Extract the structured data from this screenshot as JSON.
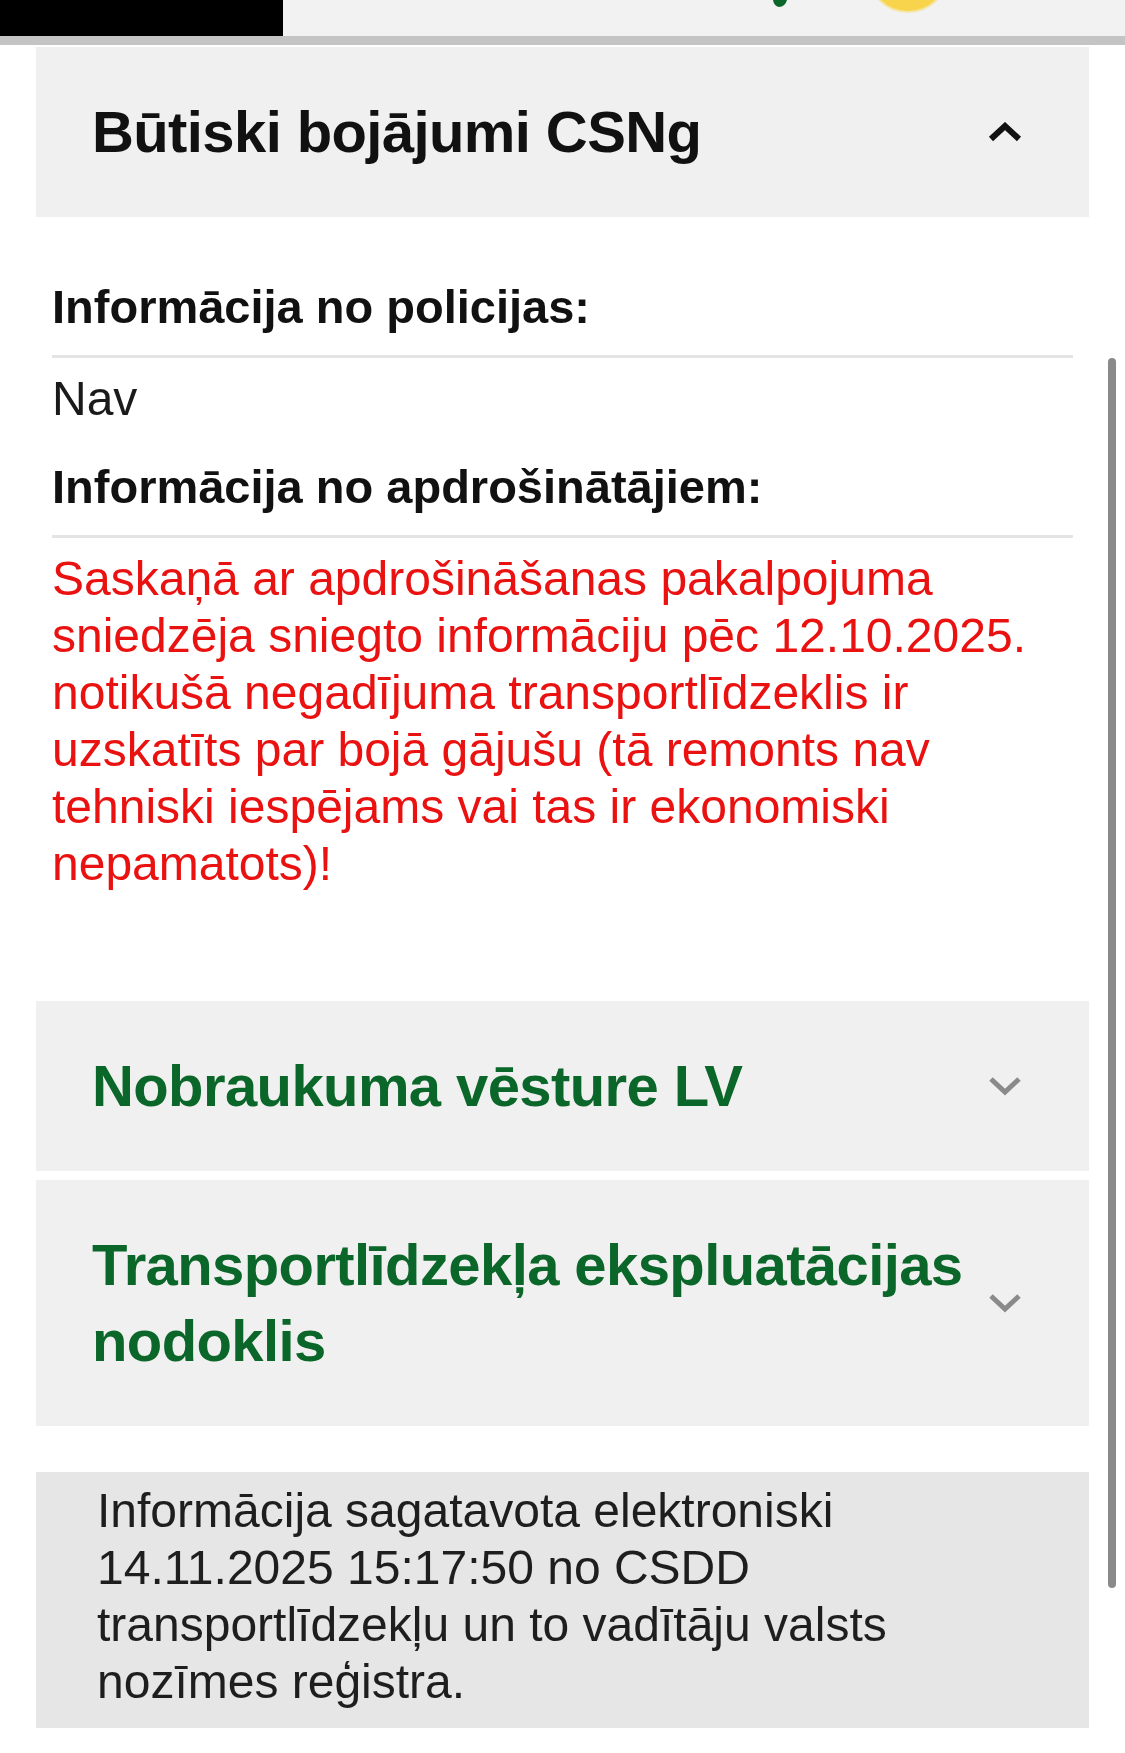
{
  "sections": [
    {
      "title": "Būtiski bojājumi CSNg",
      "expanded": true,
      "fields": [
        {
          "label": "Informācija no policijas:",
          "value": "Nav",
          "kind": "normal"
        },
        {
          "label": "Informācija no apdrošinātājiem:",
          "value": "Saskaņā ar apdrošināšanas pakalpojuma sniedzēja sniegto informāciju pēc 12.10.2025. notikušā negadījuma transportlīdzeklis ir uzskatīts par bojā gājušu (tā remonts nav tehniski iespējams vai tas ir ekonomiski nepamatots)!",
          "kind": "warning"
        }
      ]
    },
    {
      "title": "Nobraukuma vēsture LV",
      "expanded": false
    },
    {
      "title": "Transportlīdzekļa ekspluatācijas nodoklis",
      "expanded": false
    }
  ],
  "footer_note": "Informācija sagatavota elektroniski 14.11.2025 15:17:50 no CSDD transportlīdzekļu un to vadītāju valsts nozīmes reģistra."
}
